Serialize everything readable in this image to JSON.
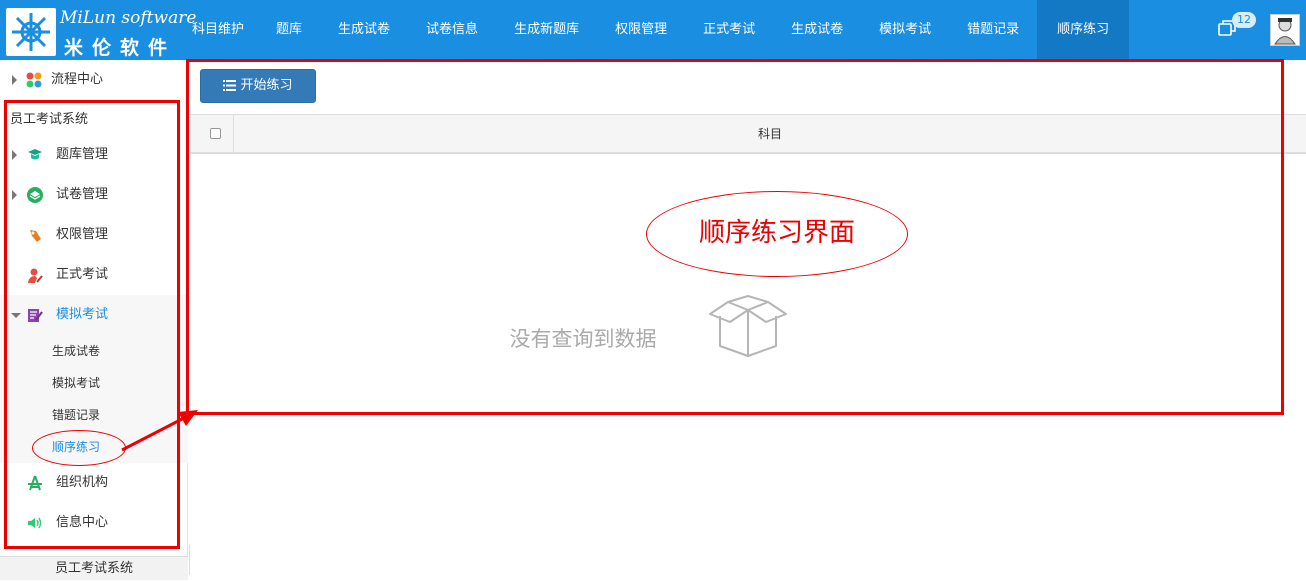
{
  "logo": {
    "en": "MiLun software",
    "cn": "米伦软件"
  },
  "nav": [
    {
      "label": "科目维护",
      "name": "nav-subject-maintenance"
    },
    {
      "label": "题库",
      "name": "nav-question-bank"
    },
    {
      "label": "生成试卷",
      "name": "nav-generate-paper"
    },
    {
      "label": "试卷信息",
      "name": "nav-paper-info"
    },
    {
      "label": "生成新题库",
      "name": "nav-new-question-bank"
    },
    {
      "label": "权限管理",
      "name": "nav-permission"
    },
    {
      "label": "正式考试",
      "name": "nav-formal-exam"
    },
    {
      "label": "生成试卷",
      "name": "nav-generate-paper-2"
    },
    {
      "label": "模拟考试",
      "name": "nav-mock-exam"
    },
    {
      "label": "错题记录",
      "name": "nav-wrong-records"
    },
    {
      "label": "顺序练习",
      "name": "nav-sequential-practice",
      "active": true
    }
  ],
  "header": {
    "message_count": "12"
  },
  "sidebar": {
    "flow_center": "流程中心",
    "system_title": "员工考试系统",
    "items": [
      {
        "label": "题库管理"
      },
      {
        "label": "试卷管理"
      },
      {
        "label": "权限管理"
      },
      {
        "label": "正式考试"
      },
      {
        "label": "模拟考试"
      }
    ],
    "sub_items": [
      {
        "label": "生成试卷"
      },
      {
        "label": "模拟考试"
      },
      {
        "label": "错题记录"
      },
      {
        "label": "顺序练习"
      }
    ],
    "bottom_items": [
      {
        "label": "组织机构"
      },
      {
        "label": "信息中心"
      }
    ],
    "footer": "员工考试系统"
  },
  "main": {
    "start_button": "开始练习",
    "table_header": "科目",
    "empty_text": "没有查询到数据"
  },
  "annotation": {
    "title": "顺序练习界面"
  },
  "colors": {
    "header": "#1a8ee1",
    "active_nav": "#1379c5",
    "button": "#337ab7",
    "annotation": "#ee0000"
  }
}
